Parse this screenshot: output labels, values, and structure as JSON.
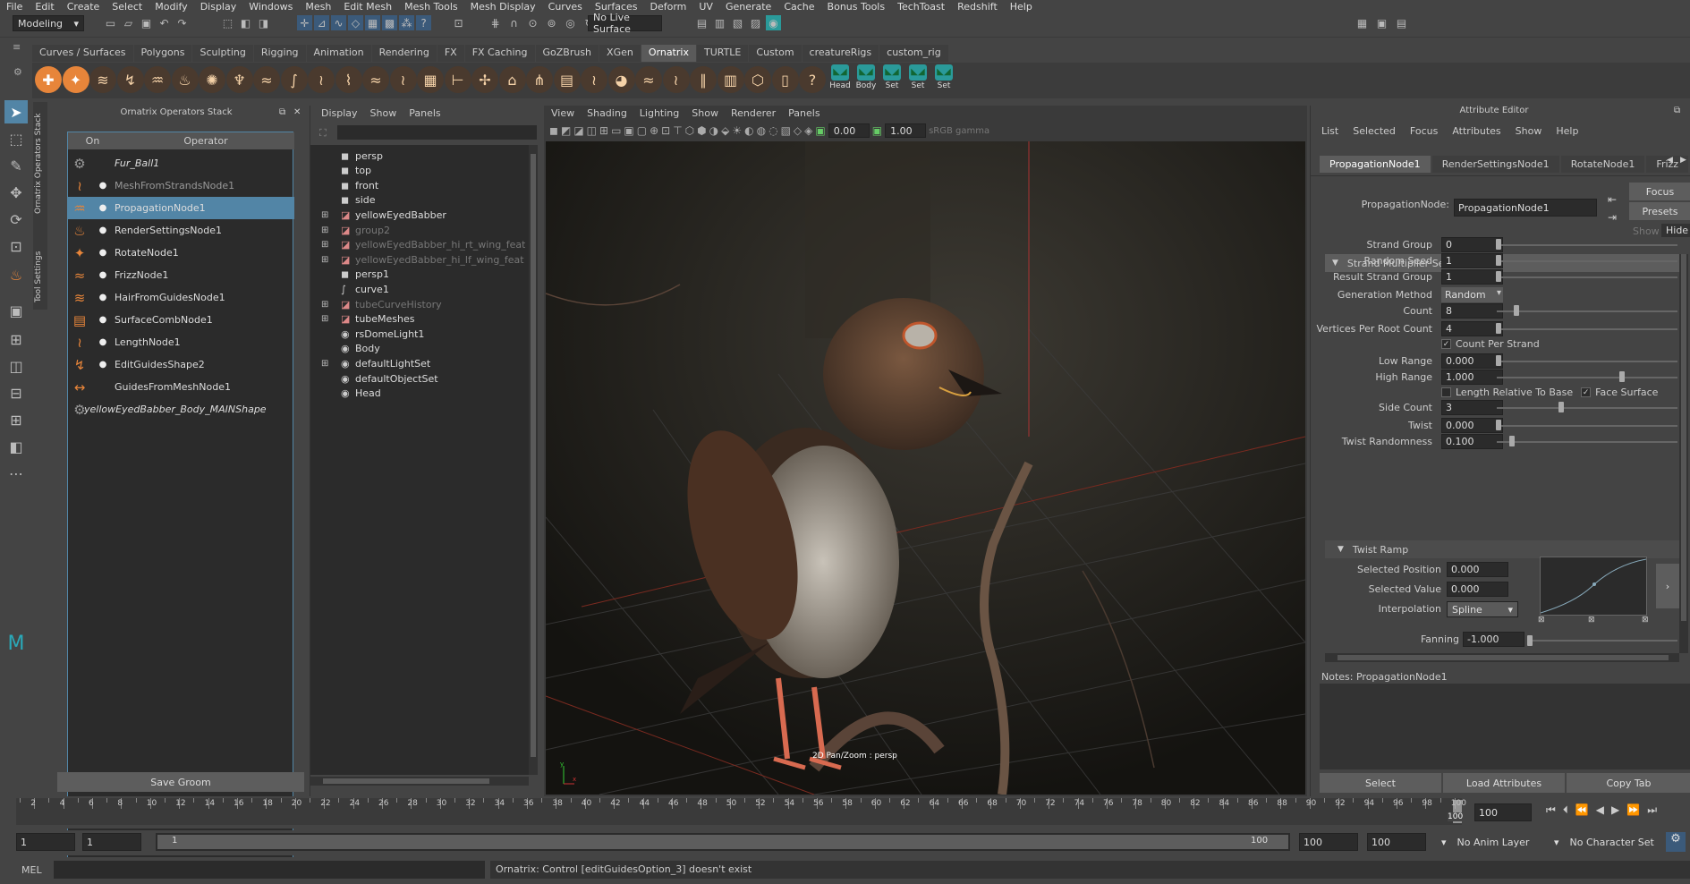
{
  "menubar": [
    "File",
    "Edit",
    "Create",
    "Select",
    "Modify",
    "Display",
    "Windows",
    "Mesh",
    "Edit Mesh",
    "Mesh Tools",
    "Mesh Display",
    "Curves",
    "Surfaces",
    "Deform",
    "UV",
    "Generate",
    "Cache",
    "Bonus Tools",
    "TechToast",
    "Redshift",
    "Help"
  ],
  "status": {
    "mode": "Modeling",
    "live_surface": "No Live Surface"
  },
  "shelf_tabs": [
    "Curves / Surfaces",
    "Polygons",
    "Sculpting",
    "Rigging",
    "Animation",
    "Rendering",
    "FX",
    "FX Caching",
    "GoZBrush",
    "XGen",
    "Ornatrix",
    "TURTLE",
    "Custom",
    "creatureRigs",
    "custom_rig"
  ],
  "shelf_active_tab": "Ornatrix",
  "shelf_labeled": [
    "Head",
    "Body",
    "Set",
    "Set",
    "Set"
  ],
  "ops_panel": {
    "title": "Ornatrix Operators Stack",
    "col_on": "On",
    "col_operator": "Operator",
    "operators": [
      "Fur_Ball1",
      "MeshFromStrandsNode1",
      "PropagationNode1",
      "RenderSettingsNode1",
      "RotateNode1",
      "FrizzNode1",
      "HairFromGuidesNode1",
      "SurfaceCombNode1",
      "LengthNode1",
      "EditGuidesShape2",
      "GuidesFromMeshNode1",
      "yellowEyedBabber_Body_MAINShape"
    ],
    "selected": "PropagationNode1",
    "save_button": "Save Groom",
    "side_tabs": [
      "Ornatrix Operators Stack",
      "Tool Settings"
    ]
  },
  "outliner": {
    "menu": [
      "Display",
      "Show",
      "Panels"
    ],
    "items": [
      "persp",
      "top",
      "front",
      "side",
      "yellowEyedBabber",
      "group2",
      "yellowEyedBabber_hi_rt_wing_feat",
      "yellowEyedBabber_hi_lf_wing_feat",
      "persp1",
      "curve1",
      "tubeCurveHistory",
      "tubeMeshes",
      "rsDomeLight1",
      "Body",
      "defaultLightSet",
      "defaultObjectSet",
      "Head"
    ]
  },
  "viewport": {
    "menu": [
      "View",
      "Shading",
      "Lighting",
      "Show",
      "Renderer",
      "Panels"
    ],
    "field_a": "0.00",
    "field_b": "1.00",
    "colorspace": "sRGB gamma",
    "hud": "2D Pan/Zoom : persp"
  },
  "attr_editor": {
    "title": "Attribute Editor",
    "menu": [
      "List",
      "Selected",
      "Focus",
      "Attributes",
      "Show",
      "Help"
    ],
    "tabs": [
      "PropagationNode1",
      "RenderSettingsNode1",
      "RotateNode1",
      "Frizz"
    ],
    "node_label": "PropagationNode:",
    "node_value": "PropagationNode1",
    "focus_btn": "Focus",
    "presets_btn": "Presets",
    "show_lbl": "Show",
    "hide_lbl": "Hide",
    "section1": "Strand Multiplier Settings",
    "fields": [
      {
        "label": "Strand Group",
        "value": "0"
      },
      {
        "label": "Random Seed",
        "value": "1"
      },
      {
        "label": "Result Strand Group",
        "value": "1"
      },
      {
        "label": "Generation Method",
        "value": "Random"
      },
      {
        "label": "Count",
        "value": "8"
      },
      {
        "label": "Vertices Per Root Count",
        "value": "4"
      },
      {
        "label": "Count Per Strand",
        "value": ""
      },
      {
        "label": "Low Range",
        "value": "0.000"
      },
      {
        "label": "High Range",
        "value": "1.000"
      },
      {
        "label": "Length Relative To Base",
        "value": ""
      },
      {
        "label": "Side Count",
        "value": "3"
      },
      {
        "label": "Twist",
        "value": "0.000"
      },
      {
        "label": "Twist Randomness",
        "value": "0.100"
      }
    ],
    "face_surface": "Face Surface",
    "section2": "Twist Ramp",
    "ramp": {
      "sel_pos_lbl": "Selected Position",
      "sel_pos": "0.000",
      "sel_val_lbl": "Selected Value",
      "sel_val": "0.000",
      "interp_lbl": "Interpolation",
      "interp": "Spline"
    },
    "fanning_lbl": "Fanning",
    "fanning": "-1.000",
    "notes": "Notes:  PropagationNode1",
    "buttons": [
      "Select",
      "Load Attributes",
      "Copy Tab"
    ]
  },
  "timeline": {
    "ticks": [
      "2",
      "4",
      "6",
      "8",
      "10",
      "12",
      "14",
      "16",
      "18",
      "20",
      "22",
      "24",
      "26",
      "28",
      "30",
      "32",
      "34",
      "36",
      "38",
      "40",
      "42",
      "44",
      "46",
      "48",
      "50",
      "52",
      "54",
      "56",
      "58",
      "60",
      "62",
      "64",
      "66",
      "68",
      "70",
      "72",
      "74",
      "76",
      "78",
      "80",
      "82",
      "84",
      "86",
      "88",
      "90",
      "92",
      "94",
      "96",
      "98",
      "100"
    ],
    "current": "100",
    "current_field": "100"
  },
  "range": {
    "start": "1",
    "start2": "1",
    "slider_start": "1",
    "slider_end": "100",
    "end": "100",
    "end2": "100",
    "anim_layer": "No Anim Layer",
    "char_set": "No Character Set"
  },
  "cmdline": {
    "label": "MEL",
    "message": "Ornatrix: Control [editGuidesOption_3] doesn't exist"
  }
}
